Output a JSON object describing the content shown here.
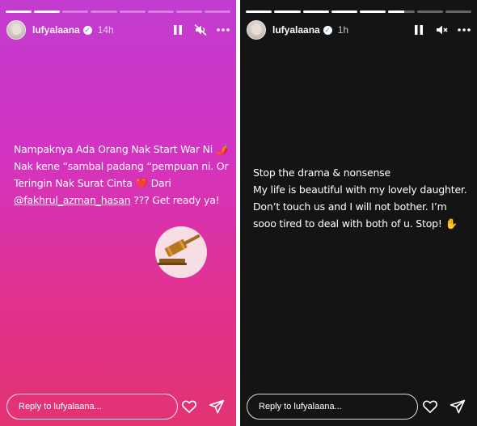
{
  "left_story": {
    "progress_fill": [
      1,
      1,
      0,
      0,
      0,
      0,
      0,
      0
    ],
    "user": {
      "name": "lufyalaana",
      "time": "14h"
    },
    "text_lines": [
      "Nampaknya Ada Orang Nak Start War Ni 🌶️",
      "Nak kene “sambal padang “pempuan ni. Or",
      "Teringin Nak Surat Cinta ❤️ Dari"
    ],
    "mention": "@fakhrul_azman_hasan",
    "mention_suffix": " ??? Get ready ya!",
    "sticker_icon": "gavel-icon",
    "reply_placeholder": "Reply to lufyalaana..."
  },
  "right_story": {
    "progress_fill": [
      1,
      1,
      1,
      1,
      1,
      0.6,
      0,
      0
    ],
    "user": {
      "name": "lufyalaana",
      "time": "1h"
    },
    "text_lines": [
      "Stop the drama & nonsense",
      "My life is beautiful with my lovely daughter.",
      "Don’t touch us and I will not bother. I’m",
      "sooo tired to deal with both of u. Stop! ✋"
    ],
    "reply_placeholder": "Reply to lufyalaana..."
  },
  "colors": {
    "left_gradient_top": "#c23cd0",
    "left_gradient_bottom": "#e33372",
    "right_background": "#141414"
  },
  "icons": [
    "pause-icon",
    "mute-icon",
    "more-icon",
    "heart-icon",
    "send-icon",
    "verified-icon"
  ]
}
